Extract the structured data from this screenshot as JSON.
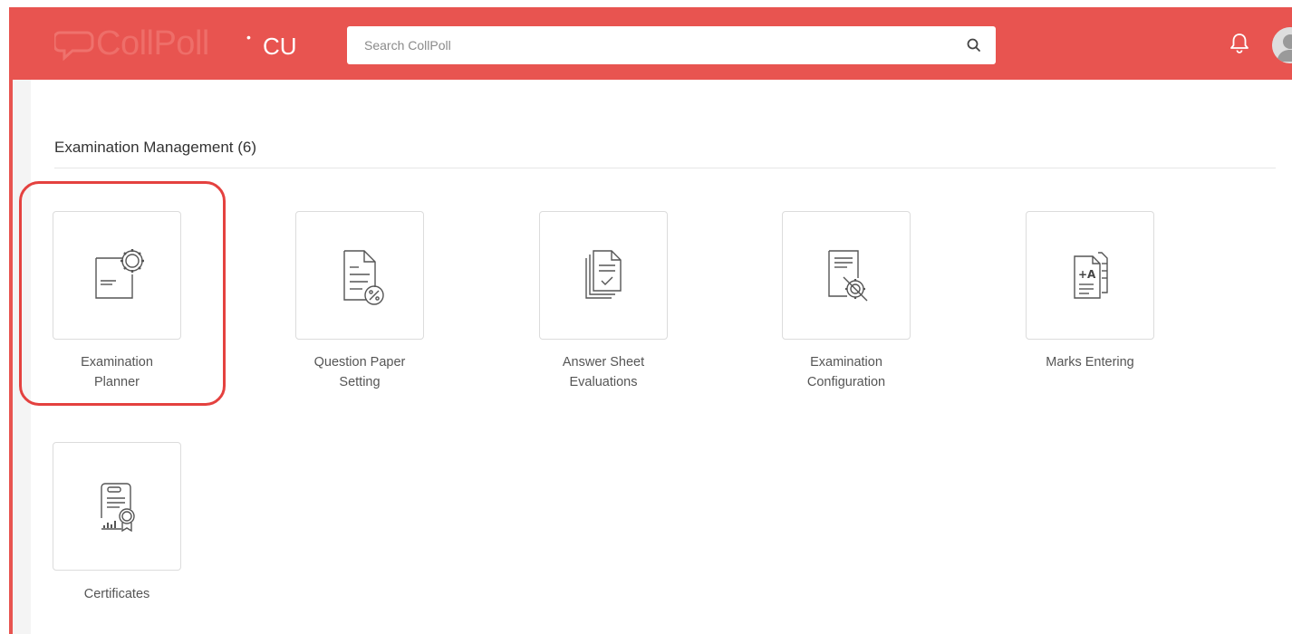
{
  "header": {
    "logo_text": "CollPoll",
    "logo_reg": "•",
    "campus": "CU",
    "search_placeholder": "Search CollPoll"
  },
  "section": {
    "title": "Examination Management (6)"
  },
  "tiles": [
    {
      "line1": "Examination",
      "line2": "Planner",
      "icon": "document-gear-icon"
    },
    {
      "line1": "Question Paper",
      "line2": "Setting",
      "icon": "document-percent-icon"
    },
    {
      "line1": "Answer Sheet",
      "line2": "Evaluations",
      "icon": "stacked-check-documents-icon"
    },
    {
      "line1": "Examination",
      "line2": "Configuration",
      "icon": "document-settings-icon"
    },
    {
      "line1": "Marks Entering",
      "line2": "",
      "icon": "grade-documents-icon"
    },
    {
      "line1": "Certificates",
      "line2": "",
      "icon": "certificate-icon"
    }
  ],
  "colors": {
    "brand": "#e85450",
    "highlight": "#e4413f"
  }
}
